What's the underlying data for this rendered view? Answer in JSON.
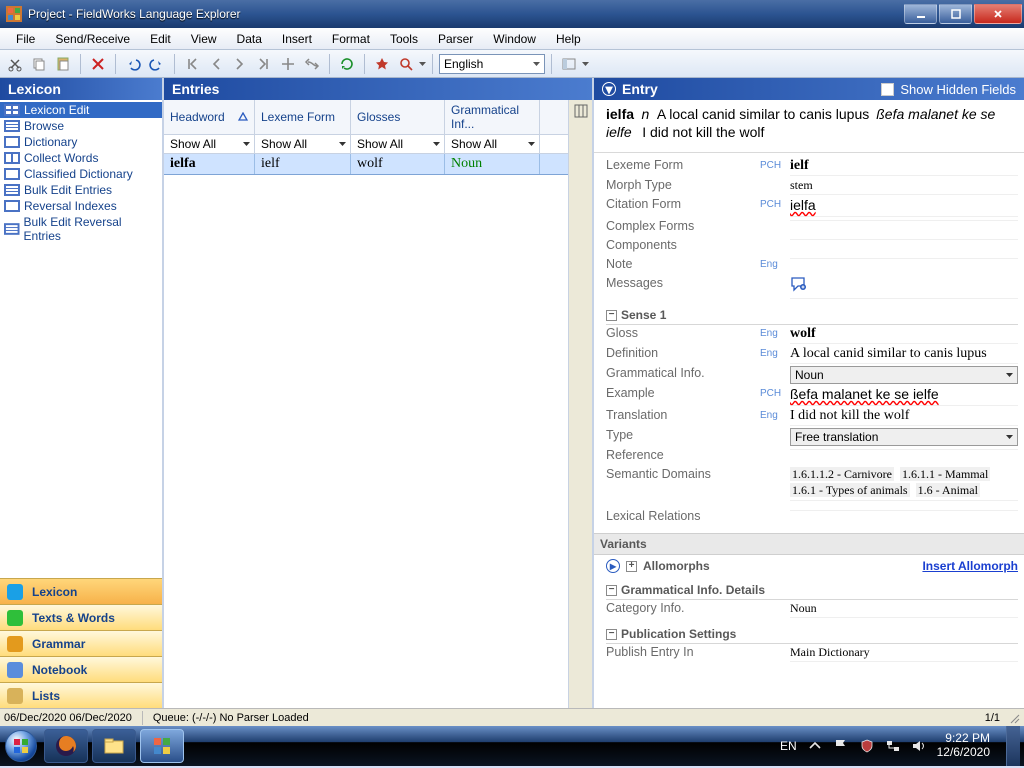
{
  "window": {
    "title": "Project - FieldWorks Language Explorer"
  },
  "menubar": [
    "File",
    "Send/Receive",
    "Edit",
    "View",
    "Data",
    "Insert",
    "Format",
    "Tools",
    "Parser",
    "Window",
    "Help"
  ],
  "toolbar": {
    "language_selector": "English"
  },
  "left": {
    "header": "Lexicon",
    "nav": [
      {
        "label": "Lexicon Edit",
        "selected": true
      },
      {
        "label": "Browse"
      },
      {
        "label": "Dictionary"
      },
      {
        "label": "Collect Words"
      },
      {
        "label": "Classified Dictionary"
      },
      {
        "label": "Bulk Edit Entries"
      },
      {
        "label": "Reversal Indexes"
      },
      {
        "label": "Bulk Edit Reversal Entries"
      }
    ],
    "areas": [
      {
        "label": "Lexicon",
        "selected": true,
        "color": "#1aa0e6"
      },
      {
        "label": "Texts & Words",
        "color": "#2fbf3a"
      },
      {
        "label": "Grammar",
        "color": "#e39a1d"
      },
      {
        "label": "Notebook",
        "color": "#5b8ddc"
      },
      {
        "label": "Lists",
        "color": "#d8b25a"
      }
    ]
  },
  "mid": {
    "header": "Entries",
    "columns": [
      "Headword",
      "Lexeme Form",
      "Glosses",
      "Grammatical Inf..."
    ],
    "filters": [
      "Show All",
      "Show All",
      "Show All",
      "Show All"
    ],
    "row": {
      "headword": "ielfa",
      "lexeme": "ielf",
      "gloss": "wolf",
      "gram": "Noun"
    }
  },
  "right": {
    "header": "Entry",
    "show_hidden": "Show Hidden Fields",
    "summary": {
      "headword": "ielfa",
      "pos": "n",
      "def": "A local canid similar to canis lupus",
      "example": "ßefa malanet ke se ielfe",
      "example_trans": "I did not kill the wolf"
    },
    "fields": {
      "lexeme_form_label": "Lexeme Form",
      "lexeme_form_ws": "PCH",
      "lexeme_form": "ielf",
      "morph_type_label": "Morph Type",
      "morph_type": "stem",
      "citation_label": "Citation Form",
      "citation_ws": "PCH",
      "citation": "ielfa",
      "complex_label": "Complex Forms",
      "components_label": "Components",
      "note_label": "Note",
      "note_ws": "Eng",
      "messages_label": "Messages",
      "sense_header": "Sense 1",
      "gloss_label": "Gloss",
      "gloss_ws": "Eng",
      "gloss": "wolf",
      "def_label": "Definition",
      "def_ws": "Eng",
      "def": "A local canid similar to canis lupus",
      "graminfo_label": "Grammatical Info.",
      "graminfo": "Noun",
      "example_label": "Example",
      "example_ws": "PCH",
      "example": "ßefa malanet ke se ielfe",
      "translation_label": "Translation",
      "translation_ws": "Eng",
      "translation": "I did not kill the wolf",
      "type_label": "Type",
      "type": "Free translation",
      "reference_label": "Reference",
      "semdom_label": "Semantic Domains",
      "semdom": [
        "1.6.1.1.2 - Carnivore",
        "1.6.1.1 - Mammal",
        "1.6.1 - Types of animals",
        "1.6 - Animal"
      ],
      "lexrel_label": "Lexical Relations",
      "variants_header": "Variants",
      "allomorphs_header": "Allomorphs",
      "insert_allomorph": "Insert Allomorph",
      "gramdet_header": "Grammatical Info. Details",
      "catinfo_label": "Category Info.",
      "catinfo": "Noun",
      "pub_header": "Publication Settings",
      "pubin_label": "Publish Entry In",
      "pubin": "Main Dictionary"
    }
  },
  "status": {
    "dates": "06/Dec/2020 06/Dec/2020",
    "queue": "Queue: (-/-/-) No Parser Loaded",
    "count": "1/1"
  },
  "taskbar": {
    "lang": "EN",
    "time": "9:22 PM",
    "date": "12/6/2020"
  }
}
